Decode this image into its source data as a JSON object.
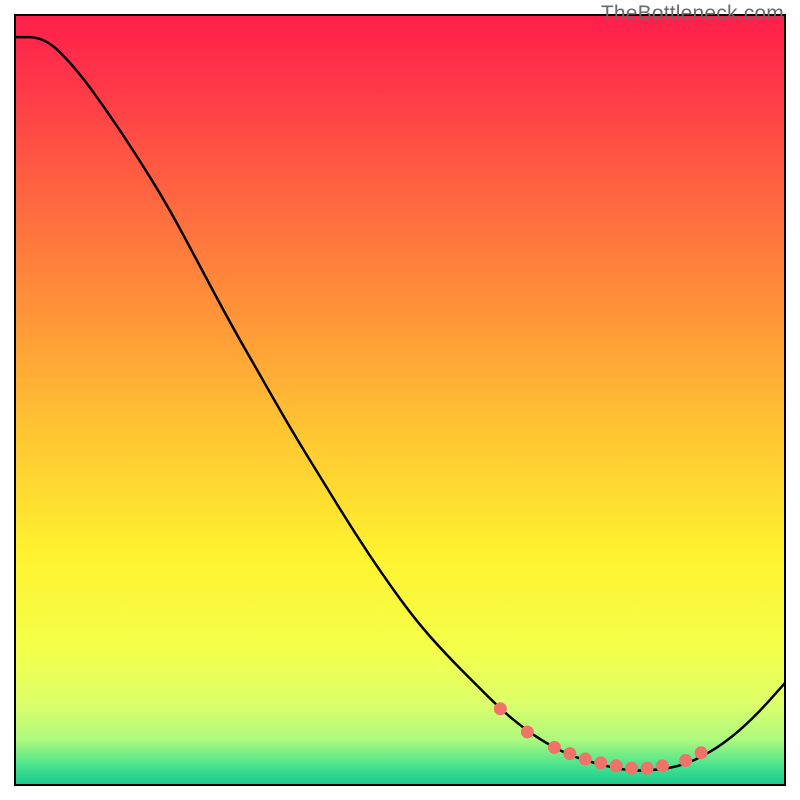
{
  "watermark": "TheBottleneck.com",
  "chart_data": {
    "type": "line",
    "title": "",
    "xlabel": "",
    "ylabel": "",
    "xlim": [
      0,
      100
    ],
    "ylim": [
      0,
      100
    ],
    "series": [
      {
        "name": "bottleneck-curve",
        "x": [
          0,
          4,
          8,
          12,
          16,
          20,
          24,
          28,
          32,
          36,
          40,
          44,
          48,
          52,
          56,
          60,
          63,
          66,
          69,
          72,
          75,
          78,
          80,
          82,
          85,
          88,
          92,
          96,
          100
        ],
        "y": [
          97,
          97,
          93,
          87.5,
          81.5,
          75,
          67.5,
          60,
          53,
          46,
          39.5,
          33,
          27,
          21.5,
          17,
          13,
          10,
          7.5,
          5.5,
          4,
          3,
          2.3,
          2,
          2,
          2.3,
          3.2,
          5.5,
          9,
          13.5
        ]
      }
    ],
    "markers": {
      "name": "optimal-range-dots",
      "color": "#ef7368",
      "x": [
        63,
        66.5,
        70,
        72,
        74,
        76,
        78,
        80,
        82,
        84,
        87,
        89
      ],
      "y": [
        10,
        7,
        5,
        4.2,
        3.5,
        3,
        2.6,
        2.3,
        2.3,
        2.6,
        3.3,
        4.3
      ]
    },
    "gradient_stops": [
      {
        "offset": 0.0,
        "color": "#ff1e4b"
      },
      {
        "offset": 0.1,
        "color": "#ff3a48"
      },
      {
        "offset": 0.25,
        "color": "#ff6a3f"
      },
      {
        "offset": 0.4,
        "color": "#ff9838"
      },
      {
        "offset": 0.55,
        "color": "#ffc832"
      },
      {
        "offset": 0.7,
        "color": "#fff22f"
      },
      {
        "offset": 0.82,
        "color": "#f4ff49"
      },
      {
        "offset": 0.89,
        "color": "#deff69"
      },
      {
        "offset": 0.94,
        "color": "#aef97d"
      },
      {
        "offset": 0.975,
        "color": "#45e28e"
      },
      {
        "offset": 1.0,
        "color": "#13c98c"
      }
    ]
  }
}
